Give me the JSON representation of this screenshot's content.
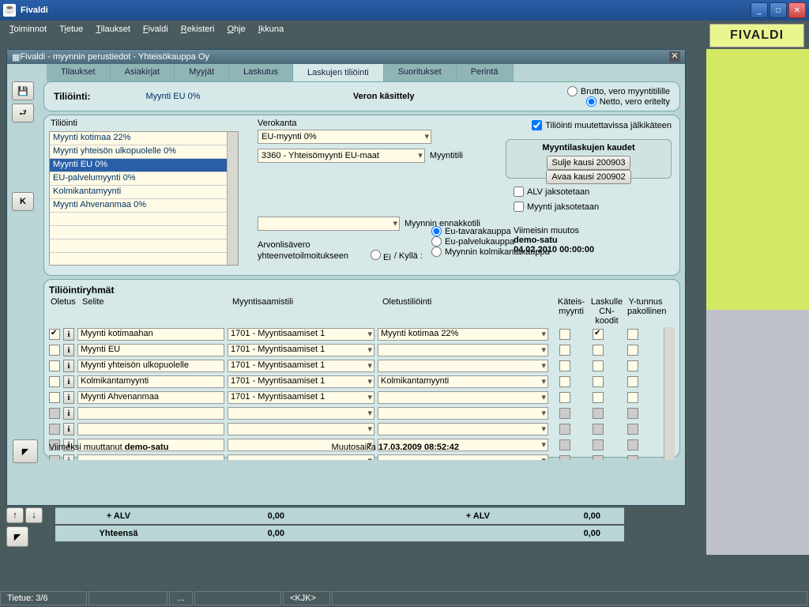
{
  "window": {
    "title": "Fivaldi"
  },
  "menubar": [
    "Toiminnot",
    "Tietue",
    "Tilaukset",
    "Fivaldi",
    "Rekisteri",
    "Ohje",
    "Ikkuna"
  ],
  "logo": "FIVALDI",
  "subwindow": {
    "title": "Fivaldi - myynnin perustiedot - Yhteisökauppa Oy"
  },
  "tabs": [
    "Tilaukset",
    "Asiakirjat",
    "Myyjät",
    "Laskutus",
    "Laskujen tiliöinti",
    "Suoritukset",
    "Perintä"
  ],
  "active_tab": 4,
  "panel1": {
    "label": "Tiliöinti:",
    "value": "Myynti EU 0%",
    "vero_label": "Veron käsittely",
    "radio1": "Brutto, vero myyntitilille",
    "radio2": "Netto, vero eritelty"
  },
  "panel2": {
    "list_label": "Tiliöinti",
    "list": [
      "Myynti kotimaa 22%",
      "Myynti yhteisön ulkopuolelle 0%",
      "Myynti EU 0%",
      "EU-palvelumyynti 0%",
      "Kolmikantamyynti",
      "Myynti Ahvenanmaa 0%"
    ],
    "selected": 2,
    "vero_label": "Verokanta",
    "vero_combo1": "EU-myynti 0%",
    "vero_combo2": "3360 - Yhteisömyynti EU-maat",
    "myyntitili_label": "Myyntitili",
    "tili_chk": "Tiliöinti muutettavissa jälkikäteen",
    "kaudet_title": "Myyntilaskujen kaudet",
    "kaudet_btn1": "Sulje kausi 200903",
    "kaudet_btn2": "Avaa kausi 200902",
    "chk_alv": "ALV jaksotetaan",
    "chk_myynti": "Myynti jaksotetaan",
    "muutos_label": "Viimeisin muutos",
    "muutos_user": "demo-satu",
    "muutos_time": "04.02.2010 00:00:00",
    "ennakko_label": "Myynnin ennakkotili",
    "arvon_l1": "Arvonlisävero",
    "arvon_l2": "yhteenvetoilmoitukseen",
    "arvon_ei": "Ei",
    "arvon_kylla": "/  Kyllä :",
    "r3a": "Eu-tavarakauppa",
    "r3b": "Eu-palvelukauppa",
    "r3c": "Myynnin kolmikantakauppa"
  },
  "panel3": {
    "title": "Tiliöintiryhmät",
    "headers": {
      "oletus": "Oletus",
      "selite": "Selite",
      "ms": "Myyntisaamistili",
      "ot": "Oletustiliöinti",
      "kat": "Käteis-\nmyynti",
      "lask": "Laskulle\nCN-koodit",
      "yt": "Y-tunnus\npakollinen"
    },
    "rows": [
      {
        "oletus": true,
        "selite": "Myynti kotimaahan",
        "ms": "1701 - Myyntisaamiset 1",
        "ot": "Myynti kotimaa 22%",
        "kat": false,
        "lask": true,
        "yt": false
      },
      {
        "oletus": false,
        "selite": "Myynti EU",
        "ms": "1701 - Myyntisaamiset 1",
        "ot": "",
        "kat": false,
        "lask": false,
        "yt": false
      },
      {
        "oletus": false,
        "selite": "Myynti yhteisön ulkopuolelle",
        "ms": "1701 - Myyntisaamiset 1",
        "ot": "",
        "kat": false,
        "lask": false,
        "yt": false
      },
      {
        "oletus": false,
        "selite": "Kolmikantamyynti",
        "ms": "1701 - Myyntisaamiset 1",
        "ot": "Kolmikantamyynti",
        "kat": false,
        "lask": false,
        "yt": false
      },
      {
        "oletus": false,
        "selite": "Myynti Ahvenanmaa",
        "ms": "1701 - Myyntisaamiset 1",
        "ot": "",
        "kat": false,
        "lask": false,
        "yt": false
      }
    ],
    "footer_label": "Viimeksi muuttanut",
    "footer_user": "demo-satu",
    "footer_time_label": "Muutosaika",
    "footer_time": "17.03.2009 08:52:42"
  },
  "summary": {
    "alv_label": "+ ALV",
    "alv_val1": "0,00",
    "alv_val2": "0,00",
    "yht_label": "Yhteensä",
    "yht_val1": "0,00",
    "yht_val2": "0,00"
  },
  "statusbar": {
    "tietue": "Tietue: 3/6",
    "dots": "...",
    "kjk": "<KJK>"
  }
}
